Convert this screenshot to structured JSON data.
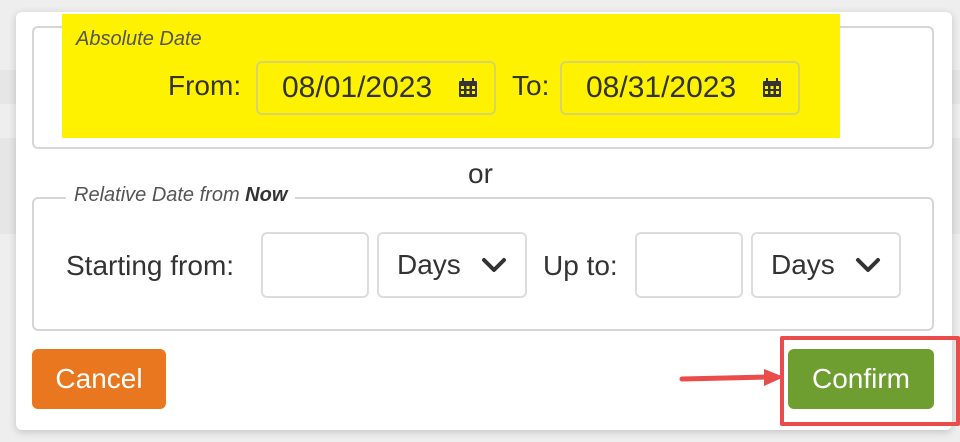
{
  "absolute": {
    "legend": "Absolute Date",
    "from_label": "From:",
    "from_value": "08/01/2023",
    "to_label": "To:",
    "to_value": "08/31/2023",
    "calendar_icon": "calendar-icon",
    "highlight_color": "#fff200"
  },
  "separator": "or",
  "relative": {
    "legend_prefix": "Relative Date from ",
    "legend_bold": "Now",
    "starting_label": "Starting from:",
    "starting_value": "",
    "starting_unit": "Days",
    "upto_label": "Up to:",
    "upto_value": "",
    "upto_unit": "Days",
    "chevron_icon": "chevron-down-icon"
  },
  "buttons": {
    "cancel": "Cancel",
    "confirm": "Confirm"
  },
  "colors": {
    "cancel": "#e8771f",
    "confirm": "#6e9e2f",
    "annotation": "#ea4b4b"
  }
}
